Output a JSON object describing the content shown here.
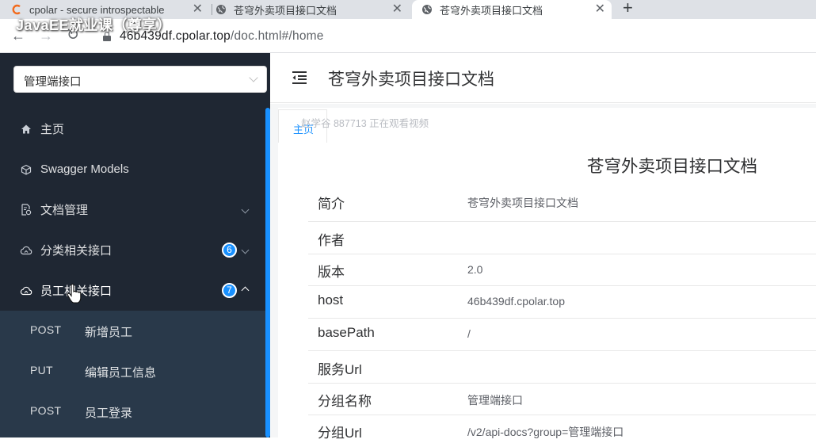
{
  "browser": {
    "tabs": [
      {
        "title": "cpolar - secure introspectable",
        "active": false,
        "icon": "cpolar-logo-icon"
      },
      {
        "title": "苍穹外卖项目接口文档",
        "active": false,
        "icon": "globe-icon"
      },
      {
        "title": "苍穹外卖项目接口文档",
        "active": true,
        "icon": "globe-icon"
      }
    ],
    "new_tab_label": "+",
    "close_glyph": "✕",
    "url_host": "46b439df.cpolar.top",
    "url_path": "/doc.html#/home",
    "overlay_watermark": "JavaEE就业课（尊享）"
  },
  "sidebar": {
    "group_select": {
      "value": "管理端接口"
    },
    "menu": [
      {
        "label": "主页",
        "icon": "home-icon"
      },
      {
        "label": "Swagger Models",
        "icon": "cube-icon"
      },
      {
        "label": "文档管理",
        "icon": "document-gear-icon",
        "expandable": true
      },
      {
        "label": "分类相关接口",
        "icon": "cloud-icon",
        "badge": "6",
        "expandable": true
      },
      {
        "label": "员工相关接口",
        "icon": "cloud-icon",
        "badge": "7",
        "expanded": true
      }
    ],
    "employee_endpoints": [
      {
        "method": "POST",
        "name": "新增员工"
      },
      {
        "method": "PUT",
        "name": "编辑员工信息"
      },
      {
        "method": "POST",
        "name": "员工登录"
      }
    ]
  },
  "header": {
    "title": "苍穹外卖项目接口文档"
  },
  "tabs": {
    "home": "主页"
  },
  "viewer_note": "赵学谷 887713 正在观看视频",
  "doc": {
    "title": "苍穹外卖项目接口文档",
    "rows": [
      {
        "key": "简介",
        "value": "苍穹外卖项目接口文档"
      },
      {
        "key": "作者",
        "value": ""
      },
      {
        "key": "版本",
        "value": "2.0"
      },
      {
        "key": "host",
        "value": "46b439df.cpolar.top"
      },
      {
        "key": "basePath",
        "value": "/"
      },
      {
        "key": "服务Url",
        "value": ""
      },
      {
        "key": "分组名称",
        "value": "管理端接口"
      },
      {
        "key": "分组Url",
        "value": "/v2/api-docs?group=管理端接口"
      }
    ]
  },
  "colors": {
    "sidebar_bg": "#1f2733",
    "submenu_bg": "#29394a",
    "accent": "#1890ff",
    "cpolar_orange": "#f26b1d"
  }
}
